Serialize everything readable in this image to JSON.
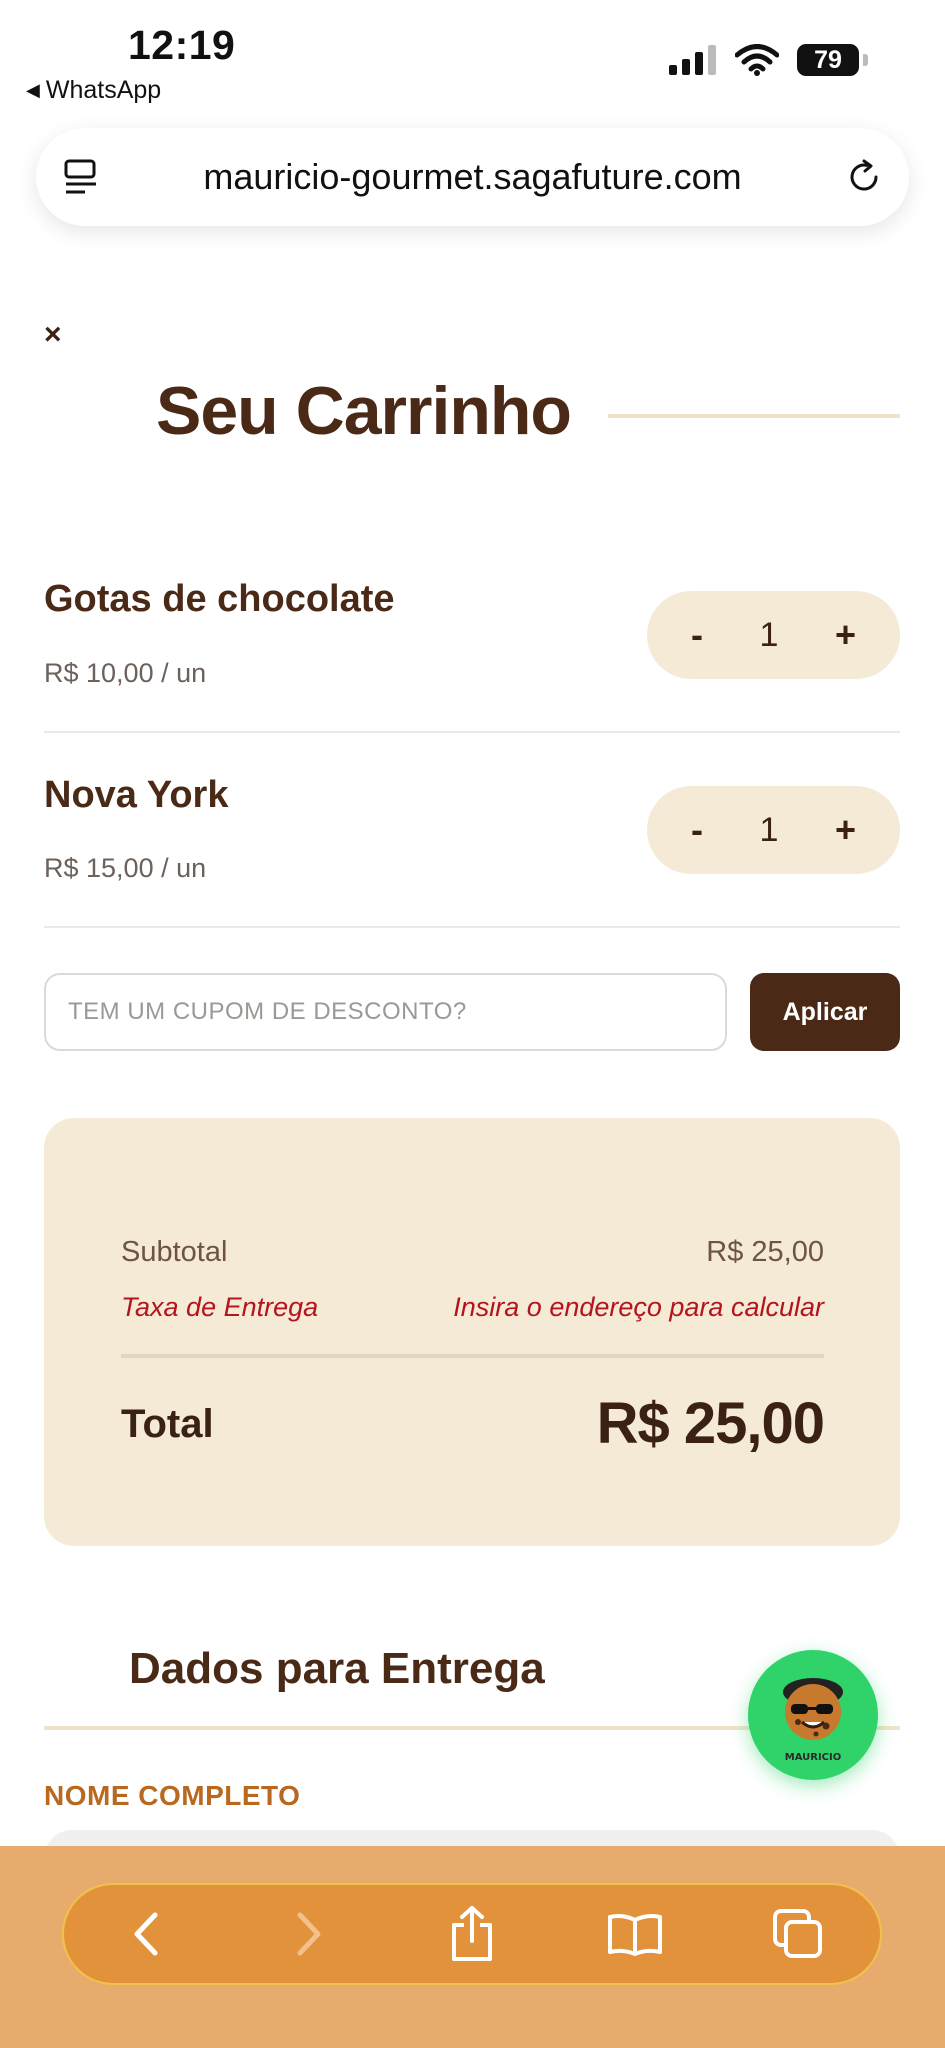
{
  "status_bar": {
    "time": "12:19",
    "back_app": "WhatsApp",
    "battery": "79"
  },
  "browser": {
    "url": "mauricio-gourmet.sagafuture.com"
  },
  "cart": {
    "close": "×",
    "title": "Seu Carrinho",
    "items": [
      {
        "name": "Gotas de chocolate",
        "price": "R$ 10,00 / un",
        "qty": "1",
        "minus": "-",
        "plus": "+"
      },
      {
        "name": "Nova York",
        "price": "R$ 15,00 / un",
        "qty": "1",
        "minus": "-",
        "plus": "+"
      }
    ],
    "coupon": {
      "placeholder": "TEM UM CUPOM DE DESCONTO?",
      "value": "",
      "apply_label": "Aplicar"
    },
    "summary": {
      "subtotal_label": "Subtotal",
      "subtotal_value": "R$ 25,00",
      "fee_label": "Taxa de Entrega",
      "fee_value": "Insira o endereço para calcular",
      "total_label": "Total",
      "total_value": "R$ 25,00"
    }
  },
  "delivery": {
    "title": "Dados para Entrega",
    "name_label": "NOME COMPLETO",
    "name_value": ""
  },
  "fab": {
    "logo_text": "MAURICIO"
  },
  "colors": {
    "brown": "#4a2a17",
    "cream": "#f4ead6",
    "fee_red": "#b3141d",
    "label_orange": "#b8691f",
    "fab_green": "#2fd36a",
    "toolbar_orange": "#e3923c"
  }
}
